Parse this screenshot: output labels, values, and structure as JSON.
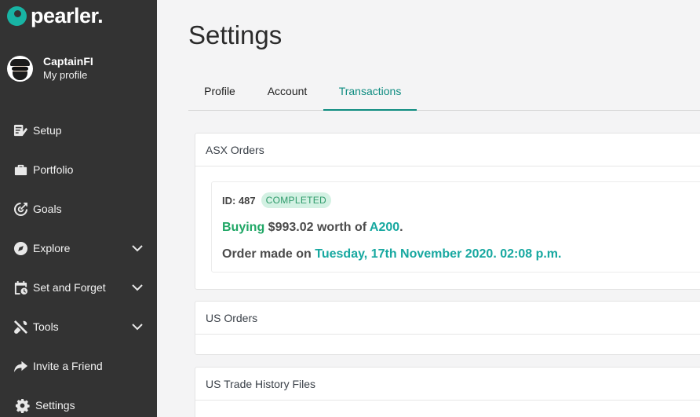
{
  "brand": {
    "name": "pearler."
  },
  "profile": {
    "name": "CaptainFI",
    "link": "My profile"
  },
  "nav": [
    {
      "label": "Setup",
      "icon": "setup-icon",
      "expandable": false
    },
    {
      "label": "Portfolio",
      "icon": "briefcase-icon",
      "expandable": false
    },
    {
      "label": "Goals",
      "icon": "target-icon",
      "expandable": false
    },
    {
      "label": "Explore",
      "icon": "compass-icon",
      "expandable": true
    },
    {
      "label": "Set and Forget",
      "icon": "calendar-clock-icon",
      "expandable": true
    },
    {
      "label": "Tools",
      "icon": "tools-icon",
      "expandable": true
    },
    {
      "label": "Invite a Friend",
      "icon": "share-arrow-icon",
      "expandable": false
    },
    {
      "label": "Settings",
      "icon": "gear-icon",
      "expandable": false
    }
  ],
  "page": {
    "title": "Settings"
  },
  "tabs": [
    {
      "label": "Profile",
      "active": false
    },
    {
      "label": "Account",
      "active": false
    },
    {
      "label": "Transactions",
      "active": true
    }
  ],
  "sections": {
    "asx": {
      "title": "ASX Orders",
      "order": {
        "id_label": "ID: 487",
        "status": "COMPLETED",
        "action": "Buying",
        "amount": "$993.02",
        "worth_of": "worth of",
        "ticker": "A200",
        "period": ".",
        "made_on_label": "Order made on",
        "date": "Tuesday, 17th November 2020. 02:08 p.m."
      }
    },
    "us": {
      "title": "US Orders"
    },
    "us_history": {
      "title": "US Trade History Files"
    }
  },
  "colors": {
    "sidebar": "#333333",
    "accent": "#0e8c80",
    "brand": "#18b4a4",
    "status_bg": "#d3f1e3",
    "status_text": "#2e9a6a"
  }
}
